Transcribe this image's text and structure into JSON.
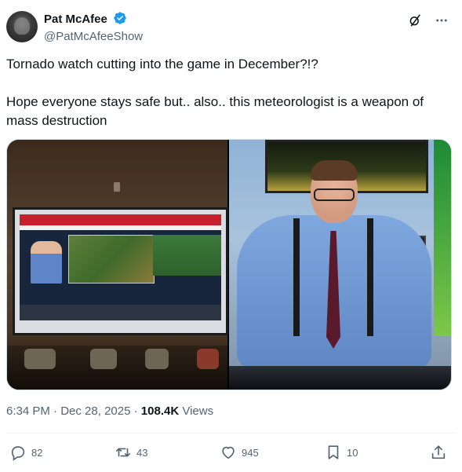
{
  "author": {
    "display_name": "Pat McAfee",
    "handle": "@PatMcAfeeShow",
    "verified": true
  },
  "tweet": {
    "text": "Tornado watch cutting into the game in December?!?\n\nHope everyone stays safe but.. also.. this meteorologist is a weapon of mass destruction",
    "time": "6:34 PM",
    "date": "Dec 28, 2025",
    "views_count": "108.4K",
    "views_label": "Views"
  },
  "actions": {
    "replies": "82",
    "reposts": "43",
    "likes": "945",
    "bookmarks": "10"
  },
  "icons": [
    "avatar",
    "verified-badge-icon",
    "grok-icon",
    "more-icon",
    "reply-icon",
    "repost-icon",
    "like-icon",
    "bookmark-icon",
    "share-icon"
  ],
  "colors": {
    "verified": "#1d9bf0",
    "muted": "#536471",
    "text": "#0f1419"
  }
}
